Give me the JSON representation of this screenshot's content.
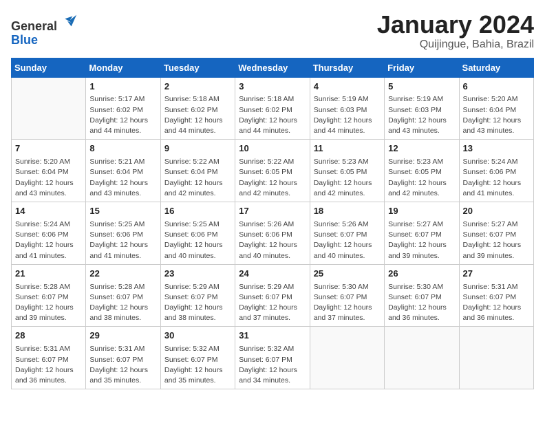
{
  "header": {
    "logo_general": "General",
    "logo_blue": "Blue",
    "title": "January 2024",
    "location": "Quijingue, Bahia, Brazil"
  },
  "weekdays": [
    "Sunday",
    "Monday",
    "Tuesday",
    "Wednesday",
    "Thursday",
    "Friday",
    "Saturday"
  ],
  "weeks": [
    [
      {
        "day": "",
        "info": ""
      },
      {
        "day": "1",
        "info": "Sunrise: 5:17 AM\nSunset: 6:02 PM\nDaylight: 12 hours\nand 44 minutes."
      },
      {
        "day": "2",
        "info": "Sunrise: 5:18 AM\nSunset: 6:02 PM\nDaylight: 12 hours\nand 44 minutes."
      },
      {
        "day": "3",
        "info": "Sunrise: 5:18 AM\nSunset: 6:02 PM\nDaylight: 12 hours\nand 44 minutes."
      },
      {
        "day": "4",
        "info": "Sunrise: 5:19 AM\nSunset: 6:03 PM\nDaylight: 12 hours\nand 44 minutes."
      },
      {
        "day": "5",
        "info": "Sunrise: 5:19 AM\nSunset: 6:03 PM\nDaylight: 12 hours\nand 43 minutes."
      },
      {
        "day": "6",
        "info": "Sunrise: 5:20 AM\nSunset: 6:04 PM\nDaylight: 12 hours\nand 43 minutes."
      }
    ],
    [
      {
        "day": "7",
        "info": "Sunrise: 5:20 AM\nSunset: 6:04 PM\nDaylight: 12 hours\nand 43 minutes."
      },
      {
        "day": "8",
        "info": "Sunrise: 5:21 AM\nSunset: 6:04 PM\nDaylight: 12 hours\nand 43 minutes."
      },
      {
        "day": "9",
        "info": "Sunrise: 5:22 AM\nSunset: 6:04 PM\nDaylight: 12 hours\nand 42 minutes."
      },
      {
        "day": "10",
        "info": "Sunrise: 5:22 AM\nSunset: 6:05 PM\nDaylight: 12 hours\nand 42 minutes."
      },
      {
        "day": "11",
        "info": "Sunrise: 5:23 AM\nSunset: 6:05 PM\nDaylight: 12 hours\nand 42 minutes."
      },
      {
        "day": "12",
        "info": "Sunrise: 5:23 AM\nSunset: 6:05 PM\nDaylight: 12 hours\nand 42 minutes."
      },
      {
        "day": "13",
        "info": "Sunrise: 5:24 AM\nSunset: 6:06 PM\nDaylight: 12 hours\nand 41 minutes."
      }
    ],
    [
      {
        "day": "14",
        "info": "Sunrise: 5:24 AM\nSunset: 6:06 PM\nDaylight: 12 hours\nand 41 minutes."
      },
      {
        "day": "15",
        "info": "Sunrise: 5:25 AM\nSunset: 6:06 PM\nDaylight: 12 hours\nand 41 minutes."
      },
      {
        "day": "16",
        "info": "Sunrise: 5:25 AM\nSunset: 6:06 PM\nDaylight: 12 hours\nand 40 minutes."
      },
      {
        "day": "17",
        "info": "Sunrise: 5:26 AM\nSunset: 6:06 PM\nDaylight: 12 hours\nand 40 minutes."
      },
      {
        "day": "18",
        "info": "Sunrise: 5:26 AM\nSunset: 6:07 PM\nDaylight: 12 hours\nand 40 minutes."
      },
      {
        "day": "19",
        "info": "Sunrise: 5:27 AM\nSunset: 6:07 PM\nDaylight: 12 hours\nand 39 minutes."
      },
      {
        "day": "20",
        "info": "Sunrise: 5:27 AM\nSunset: 6:07 PM\nDaylight: 12 hours\nand 39 minutes."
      }
    ],
    [
      {
        "day": "21",
        "info": "Sunrise: 5:28 AM\nSunset: 6:07 PM\nDaylight: 12 hours\nand 39 minutes."
      },
      {
        "day": "22",
        "info": "Sunrise: 5:28 AM\nSunset: 6:07 PM\nDaylight: 12 hours\nand 38 minutes."
      },
      {
        "day": "23",
        "info": "Sunrise: 5:29 AM\nSunset: 6:07 PM\nDaylight: 12 hours\nand 38 minutes."
      },
      {
        "day": "24",
        "info": "Sunrise: 5:29 AM\nSunset: 6:07 PM\nDaylight: 12 hours\nand 37 minutes."
      },
      {
        "day": "25",
        "info": "Sunrise: 5:30 AM\nSunset: 6:07 PM\nDaylight: 12 hours\nand 37 minutes."
      },
      {
        "day": "26",
        "info": "Sunrise: 5:30 AM\nSunset: 6:07 PM\nDaylight: 12 hours\nand 36 minutes."
      },
      {
        "day": "27",
        "info": "Sunrise: 5:31 AM\nSunset: 6:07 PM\nDaylight: 12 hours\nand 36 minutes."
      }
    ],
    [
      {
        "day": "28",
        "info": "Sunrise: 5:31 AM\nSunset: 6:07 PM\nDaylight: 12 hours\nand 36 minutes."
      },
      {
        "day": "29",
        "info": "Sunrise: 5:31 AM\nSunset: 6:07 PM\nDaylight: 12 hours\nand 35 minutes."
      },
      {
        "day": "30",
        "info": "Sunrise: 5:32 AM\nSunset: 6:07 PM\nDaylight: 12 hours\nand 35 minutes."
      },
      {
        "day": "31",
        "info": "Sunrise: 5:32 AM\nSunset: 6:07 PM\nDaylight: 12 hours\nand 34 minutes."
      },
      {
        "day": "",
        "info": ""
      },
      {
        "day": "",
        "info": ""
      },
      {
        "day": "",
        "info": ""
      }
    ]
  ]
}
